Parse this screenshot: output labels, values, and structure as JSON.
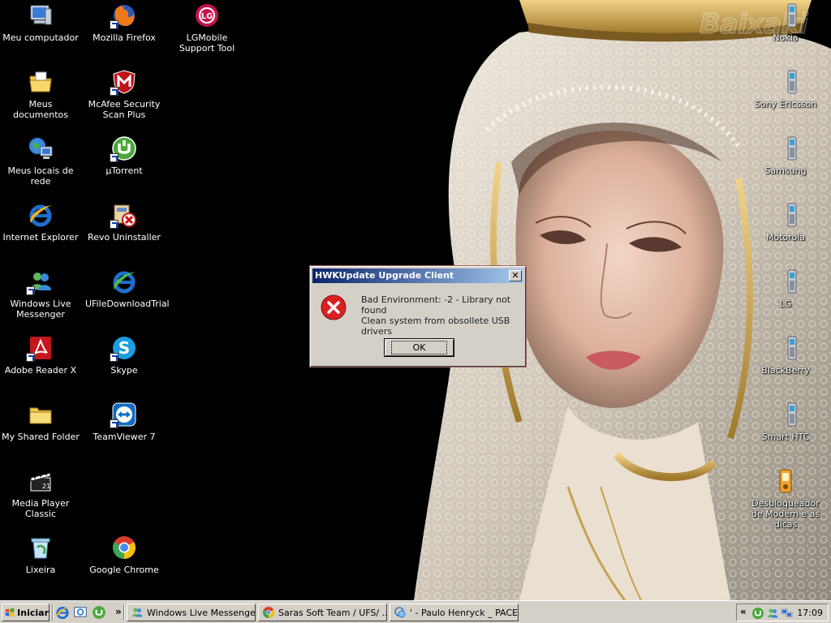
{
  "desktop": {
    "watermark": "Baixaki",
    "icons_left": [
      {
        "label": "Meu computador",
        "icon": "my-computer-icon"
      },
      {
        "label": "Meus documentos",
        "icon": "my-documents-icon"
      },
      {
        "label": "Meus locais de rede",
        "icon": "network-places-icon"
      },
      {
        "label": "Internet Explorer",
        "icon": "internet-explorer-icon"
      },
      {
        "label": "Windows Live Messenger",
        "icon": "messenger-icon"
      },
      {
        "label": "Adobe Reader X",
        "icon": "adobe-reader-icon"
      },
      {
        "label": "My Shared Folder",
        "icon": "shared-folder-icon"
      },
      {
        "label": "Media Player Classic",
        "icon": "media-player-classic-icon"
      },
      {
        "label": "Lixeira",
        "icon": "recycle-bin-icon"
      }
    ],
    "icons_mid": [
      {
        "label": "Mozilla Firefox",
        "icon": "firefox-icon"
      },
      {
        "label": "McAfee Security Scan Plus",
        "icon": "mcafee-icon"
      },
      {
        "label": "µTorrent",
        "icon": "utorrent-icon"
      },
      {
        "label": "Revo Uninstaller",
        "icon": "revo-uninstaller-icon"
      },
      {
        "label": "UFileDownloadTrial",
        "icon": "ufile-download-icon"
      },
      {
        "label": "Skype",
        "icon": "skype-icon"
      },
      {
        "label": "TeamViewer 7",
        "icon": "teamviewer-icon"
      },
      {
        "label": "Google Chrome",
        "icon": "chrome-icon"
      }
    ],
    "icons_lg": [
      {
        "label": "LGMobile Support Tool",
        "icon": "lg-icon"
      }
    ],
    "icons_right": [
      {
        "label": "Nokia",
        "icon": "phone-icon"
      },
      {
        "label": "Sony Ericsson",
        "icon": "phone-icon"
      },
      {
        "label": "Samsung",
        "icon": "phone-icon"
      },
      {
        "label": "Motorola",
        "icon": "phone-icon"
      },
      {
        "label": "LG",
        "icon": "phone-icon"
      },
      {
        "label": "BlackBerry",
        "icon": "phone-icon"
      },
      {
        "label": "Smart HTC",
        "icon": "phone-icon"
      },
      {
        "label": "Desbloqueador de Modem e as dicas",
        "icon": "modem-unlocker-icon"
      }
    ]
  },
  "dialog": {
    "title": "HWKUpdate Upgrade Client",
    "message_line1": "Bad Environment: -2 - Library not found",
    "message_line2": "Clean system from obsollete USB drivers",
    "ok_label": "OK",
    "close_label": "✕"
  },
  "taskbar": {
    "start_label": "Iniciar",
    "overflow": "»",
    "tasks": [
      {
        "label": "Windows Live Messenger"
      },
      {
        "label": "Saras Soft Team / UFS/ ..."
      },
      {
        "label": "' - Paulo Henryck _ PACE..."
      }
    ],
    "tray_expand": "«",
    "clock": "17:09"
  },
  "colors": {
    "titlebar_start": "#0a246a",
    "titlebar_end": "#a6caf0",
    "error_red": "#d92020",
    "taskbar_bg": "#d4d0c8"
  }
}
